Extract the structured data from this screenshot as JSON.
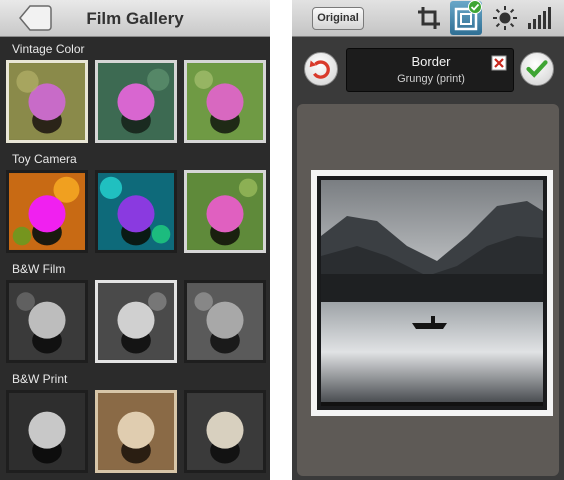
{
  "gallery": {
    "title": "Film Gallery",
    "sections": [
      {
        "label": "Vintage Color"
      },
      {
        "label": "Toy Camera"
      },
      {
        "label": "B&W Film"
      },
      {
        "label": "B&W Print"
      }
    ]
  },
  "editor": {
    "original_label": "Original",
    "tools": [
      "crop-icon",
      "border-frame-icon",
      "brightness-icon",
      "levels-icon"
    ],
    "active_tool": "border-frame-icon",
    "effect_name": "Border",
    "effect_variant": "Grungy (print)"
  },
  "colors": {
    "accent": "#3f88b3",
    "confirm_green": "#3fa534",
    "undo_red": "#d93a2b"
  }
}
